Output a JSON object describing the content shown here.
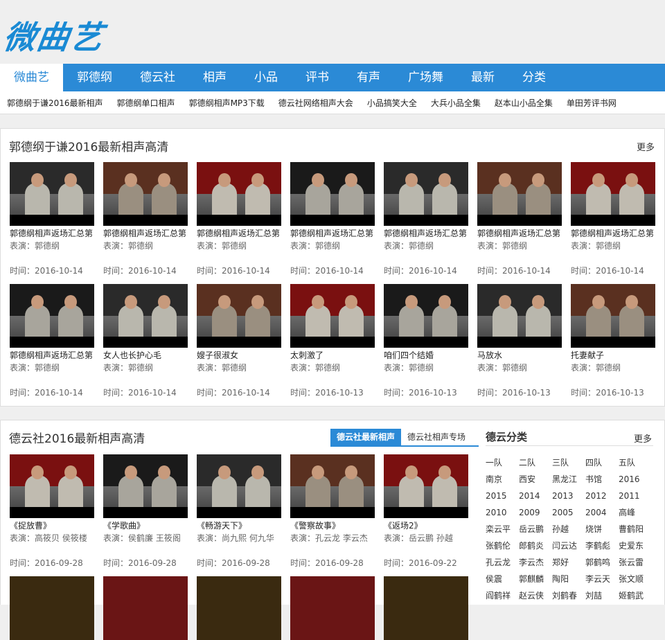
{
  "logo": "微曲艺",
  "nav": [
    "微曲艺",
    "郭德纲",
    "德云社",
    "相声",
    "小品",
    "评书",
    "有声",
    "广场舞",
    "最新",
    "分类"
  ],
  "subnav": [
    "郭德纲于谦2016最新相声",
    "郭德纲单口相声",
    "郭德纲相声MP3下载",
    "德云社网络相声大会",
    "小品搞笑大全",
    "大兵小品全集",
    "赵本山小品全集",
    "单田芳评书网"
  ],
  "section1": {
    "title": "郭德纲于谦2016最新相声高清",
    "more": "更多",
    "cards": [
      {
        "title": "郭德纲相声返场汇总第",
        "meta": "表演：郭德纲",
        "time": "时间：2016-10-14"
      },
      {
        "title": "郭德纲相声返场汇总第",
        "meta": "表演：郭德纲",
        "time": "时间：2016-10-14"
      },
      {
        "title": "郭德纲相声返场汇总第",
        "meta": "表演：郭德纲",
        "time": "时间：2016-10-14"
      },
      {
        "title": "郭德纲相声返场汇总第",
        "meta": "表演：郭德纲",
        "time": "时间：2016-10-14"
      },
      {
        "title": "郭德纲相声返场汇总第",
        "meta": "表演：郭德纲",
        "time": "时间：2016-10-14"
      },
      {
        "title": "郭德纲相声返场汇总第",
        "meta": "表演：郭德纲",
        "time": "时间：2016-10-14"
      },
      {
        "title": "郭德纲相声返场汇总第",
        "meta": "表演：郭德纲",
        "time": "时间：2016-10-14"
      },
      {
        "title": "郭德纲相声返场汇总第",
        "meta": "表演：郭德纲",
        "time": "时间：2016-10-14"
      },
      {
        "title": "女人也长护心毛",
        "meta": "表演：郭德纲",
        "time": "时间：2016-10-14"
      },
      {
        "title": "嫂子很淑女",
        "meta": "表演：郭德纲",
        "time": "时间：2016-10-14"
      },
      {
        "title": "太刺激了",
        "meta": "表演：郭德纲",
        "time": "时间：2016-10-13"
      },
      {
        "title": "咱们四个结婚",
        "meta": "表演：郭德纲",
        "time": "时间：2016-10-13"
      },
      {
        "title": "马放水",
        "meta": "表演：郭德纲",
        "time": "时间：2016-10-13"
      },
      {
        "title": "托妻献子",
        "meta": "表演：郭德纲",
        "time": "时间：2016-10-13"
      }
    ]
  },
  "section2": {
    "title": "德云社2016最新相声高清",
    "tabs": [
      "德云社最新相声",
      "德云社相声专场"
    ],
    "cards": [
      {
        "title": "《捉放曹》",
        "meta": "表演：高筱贝 侯筱楼",
        "time": "时间：2016-09-28"
      },
      {
        "title": "《学歌曲》",
        "meta": "表演：侯鹤廉 王筱阁",
        "time": "时间：2016-09-28"
      },
      {
        "title": "《畅游天下》",
        "meta": "表演：尚九熙 何九华",
        "time": "时间：2016-09-28"
      },
      {
        "title": "《警察故事》",
        "meta": "表演：孔云龙 李云杰",
        "time": "时间：2016-09-28"
      },
      {
        "title": "《返场2》",
        "meta": "表演：岳云鹏 孙越",
        "time": "时间：2016-09-22"
      }
    ],
    "category": {
      "title": "德云分类",
      "more": "更多",
      "items": [
        "一队",
        "二队",
        "三队",
        "四队",
        "五队",
        "南京",
        "西安",
        "黑龙江",
        "书馆",
        "2016",
        "2015",
        "2014",
        "2013",
        "2012",
        "2011",
        "2010",
        "2009",
        "2005",
        "2004",
        "高峰",
        "栾云平",
        "岳云鹏",
        "孙越",
        "烧饼",
        "曹鹤阳",
        "张鹤伦",
        "郎鹤炎",
        "闫云达",
        "李鹤彪",
        "史爱东",
        "孔云龙",
        "李云杰",
        "郑好",
        "郭鹤鸣",
        "张云雷",
        "侯震",
        "郭麒麟",
        "陶阳",
        "李云天",
        "张文顺",
        "阎鹤祥",
        "赵云侠",
        "刘鹤春",
        "刘喆",
        "姬鹤武"
      ]
    }
  },
  "colors": {
    "accent": "#2b8ad6",
    "logo": "#1a8ad4"
  }
}
